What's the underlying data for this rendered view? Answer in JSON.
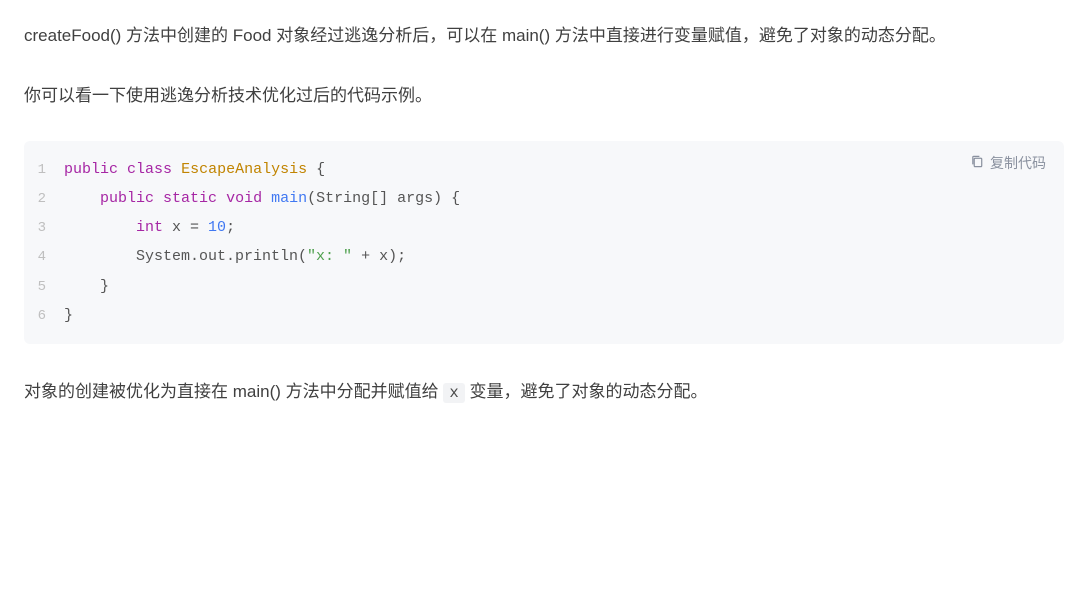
{
  "paragraphs": {
    "p1": "createFood() 方法中创建的 Food 对象经过逃逸分析后，可以在 main() 方法中直接进行变量赋值，避免了对象的动态分配。",
    "p2": "你可以看一下使用逃逸分析技术优化过后的代码示例。",
    "p3_before": "对象的创建被优化为直接在 main() 方法中分配并赋值给 ",
    "p3_code": "x",
    "p3_after": " 变量，避免了对象的动态分配。"
  },
  "copy_label": "复制代码",
  "code": {
    "lines": [
      {
        "n": "1",
        "tokens": [
          {
            "cls": "tok-keyword",
            "t": "public"
          },
          {
            "cls": "tok-plain",
            "t": " "
          },
          {
            "cls": "tok-keyword",
            "t": "class"
          },
          {
            "cls": "tok-plain",
            "t": " "
          },
          {
            "cls": "tok-class",
            "t": "EscapeAnalysis"
          },
          {
            "cls": "tok-plain",
            "t": " {"
          }
        ]
      },
      {
        "n": "2",
        "tokens": [
          {
            "cls": "tok-plain",
            "t": "    "
          },
          {
            "cls": "tok-keyword",
            "t": "public"
          },
          {
            "cls": "tok-plain",
            "t": " "
          },
          {
            "cls": "tok-keyword",
            "t": "static"
          },
          {
            "cls": "tok-plain",
            "t": " "
          },
          {
            "cls": "tok-type",
            "t": "void"
          },
          {
            "cls": "tok-plain",
            "t": " "
          },
          {
            "cls": "tok-method",
            "t": "main"
          },
          {
            "cls": "tok-plain",
            "t": "(String[] args) {"
          }
        ]
      },
      {
        "n": "3",
        "tokens": [
          {
            "cls": "tok-plain",
            "t": "        "
          },
          {
            "cls": "tok-type",
            "t": "int"
          },
          {
            "cls": "tok-plain",
            "t": " x = "
          },
          {
            "cls": "tok-number",
            "t": "10"
          },
          {
            "cls": "tok-plain",
            "t": ";"
          }
        ]
      },
      {
        "n": "4",
        "tokens": [
          {
            "cls": "tok-plain",
            "t": "        System.out.println("
          },
          {
            "cls": "tok-string",
            "t": "\"x: \""
          },
          {
            "cls": "tok-plain",
            "t": " + x);"
          }
        ]
      },
      {
        "n": "5",
        "tokens": [
          {
            "cls": "tok-plain",
            "t": "    }"
          }
        ]
      },
      {
        "n": "6",
        "tokens": [
          {
            "cls": "tok-plain",
            "t": "}"
          }
        ]
      }
    ]
  }
}
